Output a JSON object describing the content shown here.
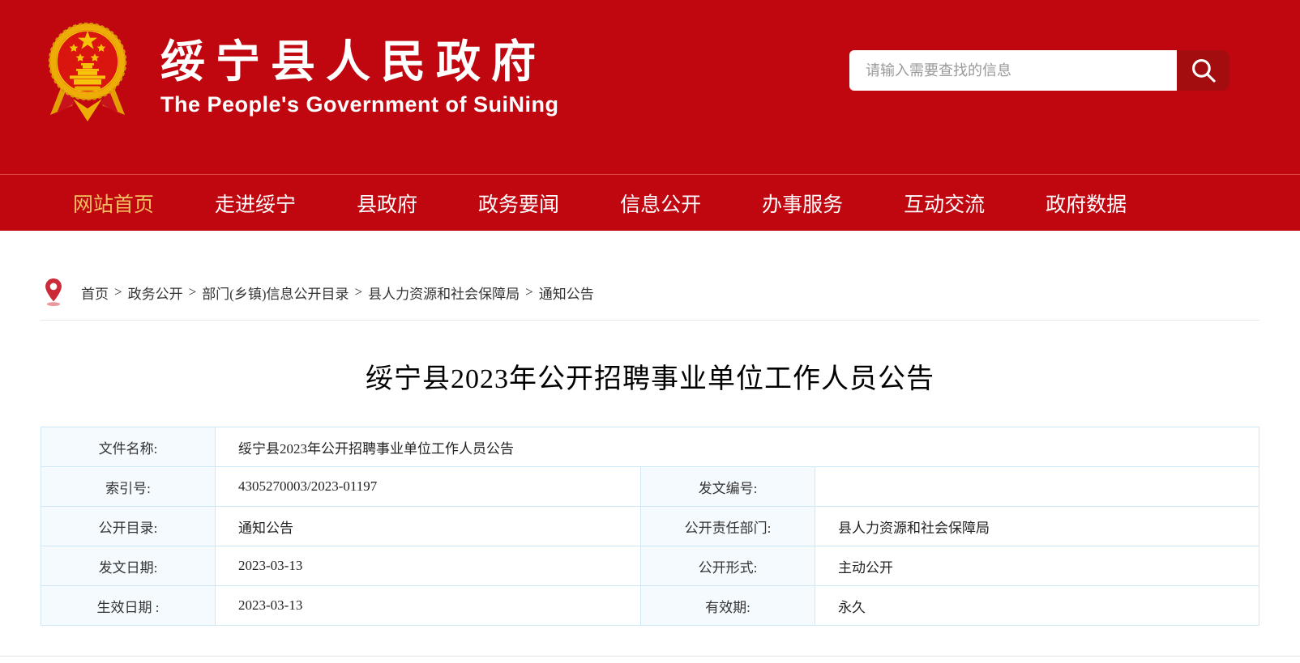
{
  "colors": {
    "primary_red": "#c00710",
    "search_button_red": "#a30d10",
    "nav_active_gold": "#f0c061",
    "table_border_blue": "#cfe8f7",
    "table_label_bg": "#f4fafe"
  },
  "header": {
    "emblem": "china-national-emblem",
    "site_title": "绥宁县人民政府",
    "site_subtitle": "The People's Government of SuiNing",
    "search": {
      "placeholder": "请输入需要查找的信息",
      "value": "",
      "icon": "search-icon"
    }
  },
  "nav": {
    "items": [
      {
        "label": "网站首页",
        "active": true
      },
      {
        "label": "走进绥宁",
        "active": false
      },
      {
        "label": "县政府",
        "active": false
      },
      {
        "label": "政务要闻",
        "active": false
      },
      {
        "label": "信息公开",
        "active": false
      },
      {
        "label": "办事服务",
        "active": false
      },
      {
        "label": "互动交流",
        "active": false
      },
      {
        "label": "政府数据",
        "active": false
      }
    ]
  },
  "breadcrumb": {
    "icon": "location-pin-icon",
    "separator": ">",
    "items": [
      "首页",
      "政务公开",
      "部门(乡镇)信息公开目录",
      "县人力资源和社会保障局",
      "通知公告"
    ]
  },
  "article": {
    "title": "绥宁县2023年公开招聘事业单位工作人员公告",
    "meta_table": {
      "rows": [
        {
          "cells": [
            {
              "type": "label",
              "text": "文件名称:"
            },
            {
              "type": "value",
              "text": "绥宁县2023年公开招聘事业单位工作人员公告",
              "span": 3
            }
          ]
        },
        {
          "cells": [
            {
              "type": "label",
              "text": "索引号:"
            },
            {
              "type": "value",
              "text": "4305270003/2023-01197"
            },
            {
              "type": "label",
              "text": "发文编号:"
            },
            {
              "type": "value",
              "text": ""
            }
          ]
        },
        {
          "cells": [
            {
              "type": "label",
              "text": "公开目录:"
            },
            {
              "type": "value",
              "text": "通知公告"
            },
            {
              "type": "label",
              "text": "公开责任部门:"
            },
            {
              "type": "value",
              "text": "县人力资源和社会保障局"
            }
          ]
        },
        {
          "cells": [
            {
              "type": "label",
              "text": "发文日期:"
            },
            {
              "type": "value",
              "text": "2023-03-13"
            },
            {
              "type": "label",
              "text": "公开形式:"
            },
            {
              "type": "value",
              "text": "主动公开"
            }
          ]
        },
        {
          "cells": [
            {
              "type": "label",
              "text": "生效日期 :"
            },
            {
              "type": "value",
              "text": "2023-03-13"
            },
            {
              "type": "label",
              "text": "有效期:"
            },
            {
              "type": "value",
              "text": "永久"
            }
          ]
        }
      ]
    }
  }
}
